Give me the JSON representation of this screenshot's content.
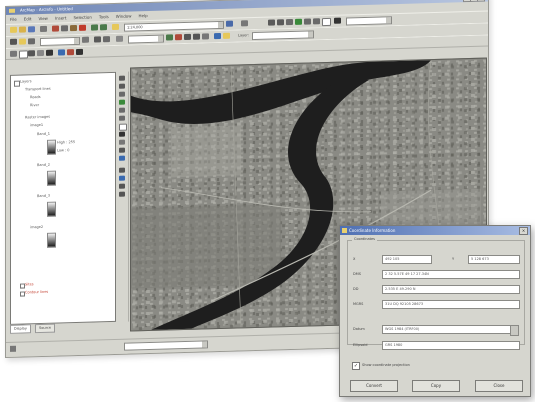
{
  "window": {
    "title": "ArcMap - ArcInfo - Untitled",
    "menus": [
      "File",
      "Edit",
      "View",
      "Insert",
      "Selection",
      "Tools",
      "Window",
      "Help"
    ],
    "toolbar_combos": [
      "1:24,000",
      "",
      "",
      ""
    ],
    "georef_label": "Layer:",
    "layer_combo": ""
  },
  "toc": {
    "title": "Layers",
    "rows": [
      {
        "text": "Layers",
        "red": false
      },
      {
        "text": "Transport lines",
        "red": false
      },
      {
        "text": "Roads",
        "red": false
      },
      {
        "text": "River",
        "red": false
      },
      {
        "text": "Raster images",
        "red": false
      },
      {
        "text": "image1",
        "red": false
      },
      {
        "text": "Band_1",
        "red": false
      },
      {
        "text": "High : 255",
        "red": false
      },
      {
        "text": "Low : 0",
        "red": false
      },
      {
        "text": "Band_2",
        "red": false
      },
      {
        "text": "Band_3",
        "red": false
      },
      {
        "text": "image2",
        "red": false
      },
      {
        "text": "Sites",
        "red": true
      },
      {
        "text": "Contour lines",
        "red": true
      }
    ],
    "tabs": [
      "Display",
      "Source"
    ]
  },
  "status": {
    "left": "",
    "combo": ""
  },
  "dialog": {
    "title": "Coordinate Information",
    "group_label": "Coordinates",
    "fields": [
      {
        "label": "X",
        "value": "492 105",
        "label2": "Y",
        "value2": "5 128 673"
      },
      {
        "label": "DMS",
        "value": "2 32 5.57E 49 17 27.34N"
      },
      {
        "label": "DD",
        "value": "2.535 E 49.290 N"
      },
      {
        "label": "MGRS",
        "value": "31U DQ 92105 28673"
      }
    ],
    "extra": [
      {
        "label": "Datum",
        "value": "WGS 1984 (ITRF00)"
      },
      {
        "label": "Ellipsoid",
        "value": "GRS 1980"
      }
    ],
    "checkbox_label": "Show coordinate projection",
    "checked": true,
    "buttons": [
      "Convert",
      "Copy",
      "Close"
    ]
  },
  "colors": {
    "titlebar": "#6f86b6",
    "dialog_titlebar": "#4e6fb2",
    "river": "#1e1e1e",
    "land": "#8c8c86"
  }
}
